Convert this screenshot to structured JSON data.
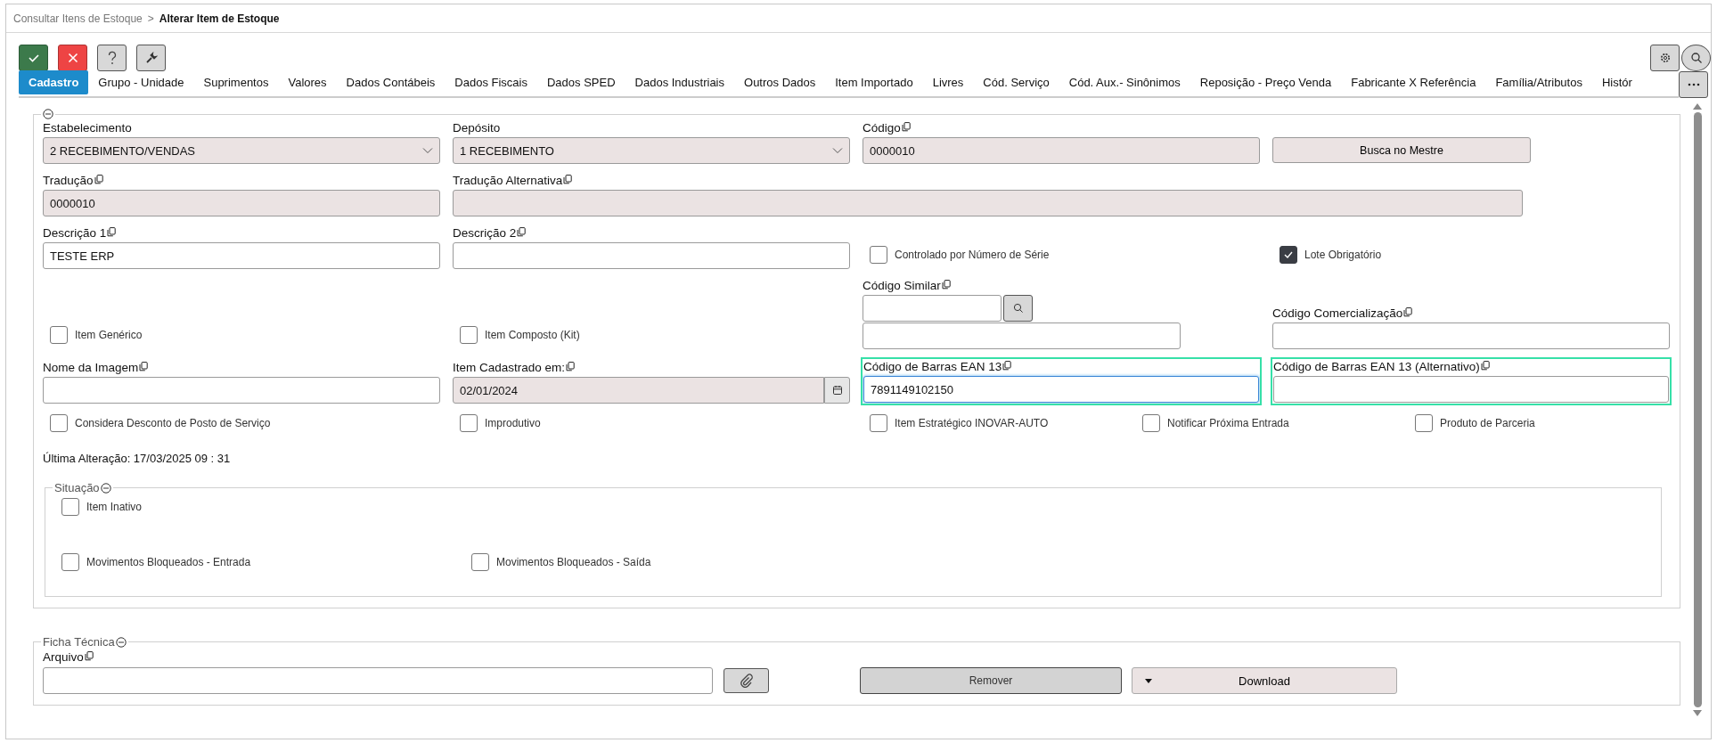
{
  "breadcrumb": {
    "parent": "Consultar Itens de Estoque",
    "separator": ">",
    "current": "Alterar Item de Estoque"
  },
  "toolbar": [
    {
      "kind": "confirm"
    },
    {
      "kind": "cancel"
    },
    {
      "kind": "help"
    },
    {
      "kind": "tools"
    }
  ],
  "toolbar_right": [
    {
      "kind": "settings"
    },
    {
      "kind": "search"
    }
  ],
  "tabs": [
    {
      "label": "Cadastro",
      "selected": true
    },
    {
      "label": "Grupo - Unidade",
      "selected": false
    },
    {
      "label": "Suprimentos",
      "selected": false
    },
    {
      "label": "Valores",
      "selected": false
    },
    {
      "label": "Dados Contábeis",
      "selected": false
    },
    {
      "label": "Dados Fiscais",
      "selected": false
    },
    {
      "label": "Dados SPED",
      "selected": false
    },
    {
      "label": "Dados Industriais",
      "selected": false
    },
    {
      "label": "Outros Dados",
      "selected": false
    },
    {
      "label": "Item Importado",
      "selected": false
    },
    {
      "label": "Livres",
      "selected": false
    },
    {
      "label": "Cód. Serviço",
      "selected": false
    },
    {
      "label": "Cód. Aux.- Sinônimos",
      "selected": false
    },
    {
      "label": "Reposição - Preço Venda",
      "selected": false
    },
    {
      "label": "Fabricante X Referência",
      "selected": false
    },
    {
      "label": "Família/Atributos",
      "selected": false
    },
    {
      "label": "Histór",
      "selected": false
    }
  ],
  "fields": [
    {
      "kind": "select",
      "label": "Estabelecimento",
      "copyable": false,
      "value": "2 RECEBIMENTO/VENDAS"
    },
    {
      "kind": "select",
      "label": "Depósito",
      "copyable": false,
      "value": "1 RECEBIMENTO"
    },
    {
      "kind": "readonly",
      "label": "Código",
      "copyable": true,
      "value": "0000010"
    },
    {
      "kind": "button",
      "label": "Busca no Mestre"
    },
    {
      "kind": "readonly",
      "label": "Tradução",
      "copyable": true,
      "value": "0000010"
    },
    {
      "kind": "readonly",
      "label": "Tradução Alternativa",
      "copyable": true
    },
    {
      "kind": "text",
      "label": "Descrição 1",
      "copyable": true,
      "value": "TESTE ERP"
    },
    {
      "kind": "text",
      "label": "Descrição 2",
      "copyable": true
    },
    {
      "kind": "checkbox",
      "label": "Controlado por Número de Série",
      "checked": false
    },
    {
      "kind": "checkbox",
      "label": "Lote Obrigatório",
      "checked": true
    },
    {
      "kind": "search",
      "label": "Código Similar",
      "copyable": true
    },
    {
      "kind": "checkbox",
      "label": "Item Genérico",
      "checked": false
    },
    {
      "kind": "checkbox",
      "label": "Item Composto (Kit)",
      "checked": false
    },
    {
      "kind": "text",
      "label": "Código Comercialização",
      "copyable": true
    },
    {
      "kind": "text",
      "label": "Nome da Imagem",
      "copyable": true
    },
    {
      "kind": "date",
      "label": "Item Cadastrado em:",
      "copyable": true,
      "value": "02/01/2024"
    },
    {
      "kind": "text",
      "label": "Código de Barras EAN 13",
      "copyable": true,
      "value": "7891149102150",
      "highlighted": true,
      "focused": true
    },
    {
      "kind": "text",
      "label": "Código de Barras EAN 13 (Alternativo)",
      "copyable": true,
      "highlighted": true,
      "focused": false
    }
  ],
  "flags": [
    {
      "label": "Considera Desconto de Posto de Serviço",
      "checked": false
    },
    {
      "label": "Improdutivo",
      "checked": false
    },
    {
      "label": "Item Estratégico INOVAR-AUTO",
      "checked": false
    },
    {
      "label": "Notificar Próxima Entrada",
      "checked": false
    },
    {
      "label": "Produto de Parceria",
      "checked": false
    }
  ],
  "last_change": "Última Alteração: 17/03/2025 09 : 31",
  "situacao": {
    "legend": "Situação",
    "items": [
      {
        "label": "Item Inativo",
        "checked": false
      },
      {
        "label": "Movimentos Bloqueados - Entrada",
        "checked": false
      },
      {
        "label": "Movimentos Bloqueados - Saída",
        "checked": false
      }
    ]
  },
  "ficha": {
    "legend": "Ficha Técnica",
    "file_label": "Arquivo",
    "remove": "Remover",
    "download": "Download"
  }
}
